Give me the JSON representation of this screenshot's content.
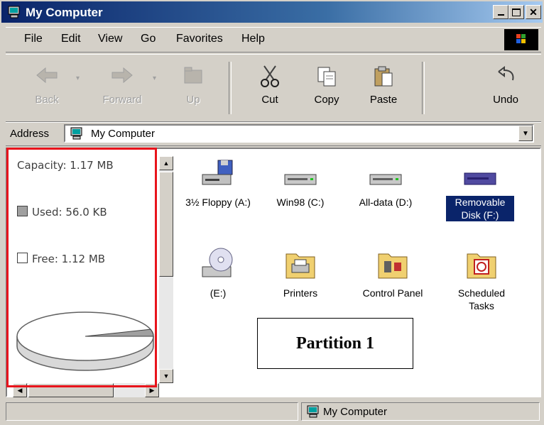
{
  "window": {
    "title": "My Computer",
    "controls": [
      "minimize",
      "maximize",
      "close"
    ]
  },
  "menu": [
    {
      "label": "File"
    },
    {
      "label": "Edit"
    },
    {
      "label": "View"
    },
    {
      "label": "Go"
    },
    {
      "label": "Favorites"
    },
    {
      "label": "Help"
    }
  ],
  "toolbar": {
    "back": {
      "label": "Back",
      "enabled": false
    },
    "forward": {
      "label": "Forward",
      "enabled": false
    },
    "up": {
      "label": "Up",
      "enabled": false
    },
    "cut": {
      "label": "Cut",
      "enabled": true
    },
    "copy": {
      "label": "Copy",
      "enabled": true
    },
    "paste": {
      "label": "Paste",
      "enabled": true
    },
    "undo": {
      "label": "Undo",
      "enabled": true
    }
  },
  "address": {
    "label": "Address",
    "value": "My Computer"
  },
  "info_pane": {
    "capacity": "Capacity: 1.17 MB",
    "used": "Used: 56.0 KB",
    "free": "Free: 1.12 MB",
    "used_fraction": 0.047,
    "used_color": "#a0a0a0",
    "free_color": "#ffffff"
  },
  "items": [
    {
      "label": "3½ Floppy (A:)",
      "icon": "floppy-drive-icon",
      "selected": false
    },
    {
      "label": "Win98 (C:)",
      "icon": "hard-disk-icon",
      "selected": false
    },
    {
      "label": "All-data (D:)",
      "icon": "hard-disk-icon",
      "selected": false
    },
    {
      "label": "Removable Disk (F:)",
      "icon": "removable-disk-icon",
      "selected": true
    },
    {
      "label": "(E:)",
      "icon": "cd-drive-icon",
      "selected": false
    },
    {
      "label": "Printers",
      "icon": "printers-folder-icon",
      "selected": false
    },
    {
      "label": "Control Panel",
      "icon": "control-panel-icon",
      "selected": false
    },
    {
      "label": "Scheduled Tasks",
      "icon": "scheduled-tasks-icon",
      "selected": false
    }
  ],
  "annotation": {
    "label": "Partition 1",
    "highlight_color": "#e8141c"
  },
  "status": {
    "text": "My Computer"
  },
  "colors": {
    "title_start": "#0a246a",
    "title_end": "#a6caf0",
    "selection": "#0a246a",
    "chrome": "#d4d0c8"
  }
}
